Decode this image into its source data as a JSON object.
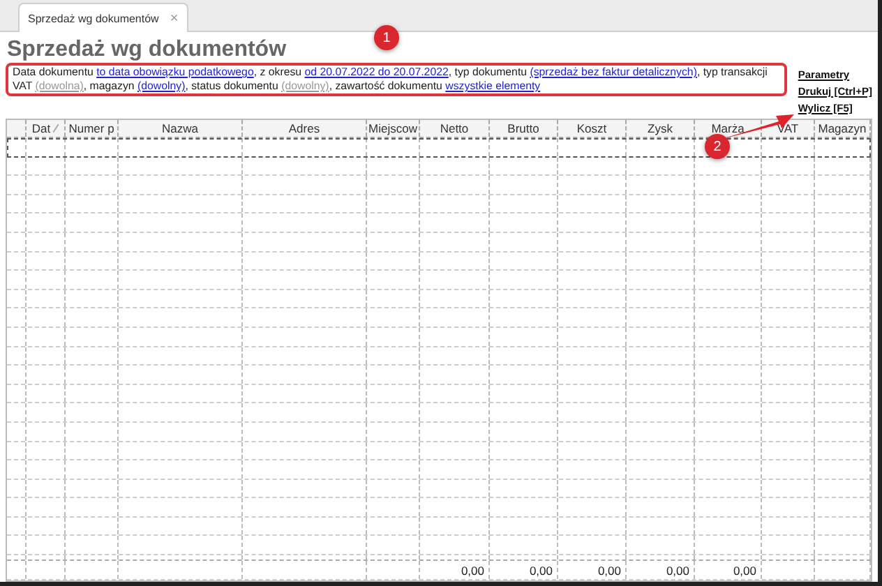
{
  "tab": {
    "label": "Sprzedaż wg dokumentów",
    "close": "×"
  },
  "title": "Sprzedaż wg dokumentów",
  "filter": [
    {
      "kind": "text",
      "text": "Data dokumentu "
    },
    {
      "kind": "link",
      "text": "to data obowiązku podatkowego"
    },
    {
      "kind": "text",
      "text": ", z okresu "
    },
    {
      "kind": "link",
      "text": "od 20.07.2022 do 20.07.2022"
    },
    {
      "kind": "text",
      "text": ", typ dokumentu "
    },
    {
      "kind": "link",
      "text": "(sprzedaż bez faktur detalicznych)"
    },
    {
      "kind": "text",
      "text": ", typ transakcji VAT "
    },
    {
      "kind": "muted",
      "text": "(dowolna)"
    },
    {
      "kind": "text",
      "text": ", magazyn "
    },
    {
      "kind": "link",
      "text": "(dowolny)"
    },
    {
      "kind": "text",
      "text": ", status dokumentu "
    },
    {
      "kind": "muted",
      "text": "(dowolny)"
    },
    {
      "kind": "text",
      "text": ", zawartość dokumentu "
    },
    {
      "kind": "link",
      "text": "wszystkie elementy"
    }
  ],
  "actions": [
    "Parametry",
    "Drukuj [Ctrl+P]",
    "Wylicz [F5]"
  ],
  "annotations": [
    "1",
    "2"
  ],
  "table": {
    "columns": [
      {
        "label": "Dat",
        "sorted": true
      },
      {
        "label": "Numer p",
        "sorted": false
      },
      {
        "label": "Nazwa",
        "sorted": false
      },
      {
        "label": "Adres",
        "sorted": false
      },
      {
        "label": "Miejscow",
        "sorted": false
      },
      {
        "label": "Netto",
        "sorted": false,
        "total": "0,00"
      },
      {
        "label": "Brutto",
        "sorted": false,
        "total": "0,00"
      },
      {
        "label": "Koszt",
        "sorted": false,
        "total": "0,00"
      },
      {
        "label": "Zysk",
        "sorted": false,
        "total": "0,00"
      },
      {
        "label": "Marża",
        "sorted": false,
        "total": "0,00"
      },
      {
        "label": "VAT",
        "sorted": false
      },
      {
        "label": "Magazyn",
        "sorted": false
      }
    ]
  }
}
